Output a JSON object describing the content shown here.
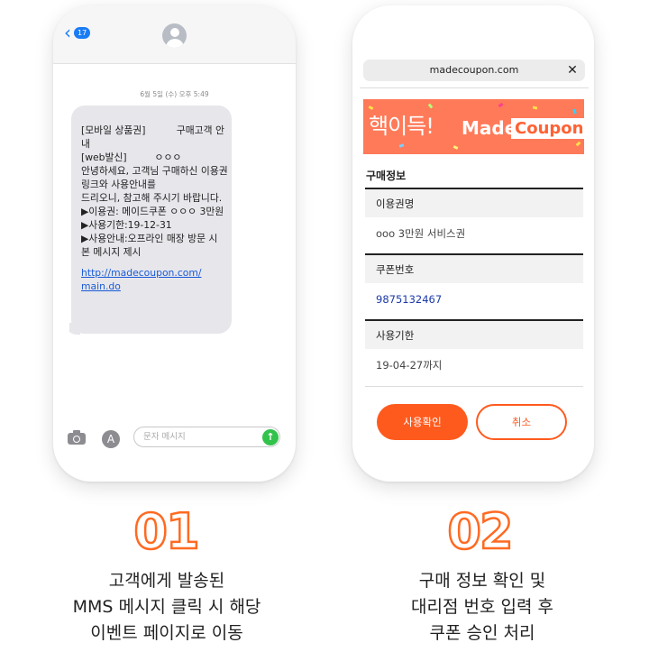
{
  "sms": {
    "back_count": "17",
    "timestamp": "6월 5일 (수) 오후 5:49",
    "message_lines": [
      "[모바일 상품권]          구매고객 안",
      "내",
      "[web발신]         ㅇㅇㅇ",
      "안녕하세요, 고객님 구매하신 이용권",
      "링크와 사용안내를",
      "드리오니, 참고해 주시기 바랍니다.",
      "",
      "▶이용권: 메이드쿠폰 ㅇㅇㅇ 3만원",
      "▶사용기한:19-12-31",
      "▶사용안내:오프라인 매장 방문 시",
      "본 메시지 제시"
    ],
    "link_lines": [
      "http://madecoupon.com/",
      "main.do"
    ],
    "input_placeholder": "문자 메시지",
    "apps_glyph": "A",
    "send_glyph": "↑"
  },
  "coupon_page": {
    "url": "madecoupon.com",
    "close_glyph": "✕",
    "banner": {
      "headline": "핵이득!",
      "brand_made": "Made",
      "brand_coupon": "Coupon"
    },
    "section_title": "구매정보",
    "fields": [
      {
        "label": "이용권명",
        "value": "ooo 3만원 서비스권"
      },
      {
        "label": "쿠폰번호",
        "value": "9875132467"
      },
      {
        "label": "사용기한",
        "value": "19-04-27까지"
      }
    ],
    "confirm_label": "사용확인",
    "cancel_label": "취소"
  },
  "steps": [
    {
      "number": "01",
      "lines": [
        "고객에게 발송된",
        "MMS 메시지 클릭 시 해당",
        "이벤트 페이지로 이동"
      ]
    },
    {
      "number": "02",
      "lines": [
        "구매 정보 확인 및",
        "대리점 번호 입력 후",
        "쿠폰 승인 처리"
      ]
    }
  ],
  "colors": {
    "accent": "#ff5a1e",
    "banner": "#ff7a59",
    "ios_blue": "#1a7cf5",
    "link": "#1a5bd6",
    "send": "#33c24b"
  }
}
